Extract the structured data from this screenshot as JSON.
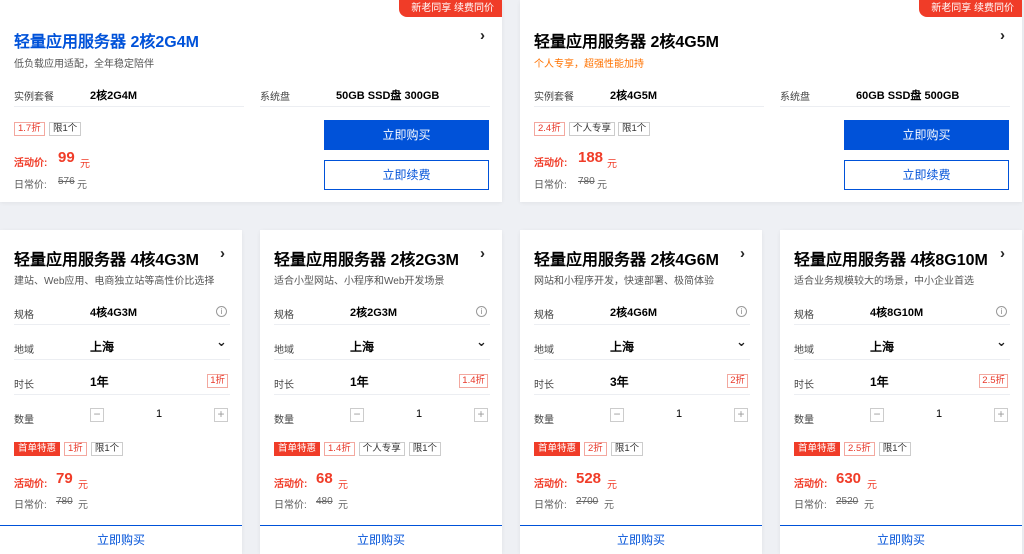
{
  "top_cards": [
    {
      "ribbon": "新老同享 续费同价",
      "title": "轻量应用服务器 2核2G4M",
      "subtitle": "低负载应用适配，全年稳定陪伴",
      "spec_label": "实例套餐",
      "spec_value": "2核2G4M",
      "disk_label": "系统盘",
      "disk_value": "50GB SSD盘 300GB",
      "tags": [
        "1.7折",
        "限1个"
      ],
      "price_label": "活动价:",
      "price": "99",
      "unit": "元",
      "orig_label": "日常价:",
      "orig_price": "576",
      "orig_unit": "元",
      "buy_label": "立即购买",
      "renew_label": "立即续费"
    },
    {
      "ribbon": "新老同享 续费同价",
      "title": "轻量应用服务器 2核4G5M",
      "subtitle": "个人专享，超强性能加持",
      "spec_label": "实例套餐",
      "spec_value": "2核4G5M",
      "disk_label": "系统盘",
      "disk_value": "60GB SSD盘 500GB",
      "tags": [
        "2.4折",
        "个人专享",
        "限1个"
      ],
      "price_label": "活动价:",
      "price": "188",
      "unit": "元",
      "orig_label": "日常价:",
      "orig_price": "780",
      "orig_unit": "元",
      "buy_label": "立即购买",
      "renew_label": "立即续费"
    }
  ],
  "cards": [
    {
      "title": "轻量应用服务器 4核4G3M",
      "subtitle": "建站、Web应用、电商独立站等高性价比选择",
      "spec_label": "规格",
      "spec_value": "4核4G3M",
      "region_label": "地域",
      "region_value": "上海",
      "duration_label": "时长",
      "duration_value": "1年",
      "duration_discount": "1折",
      "qty_label": "数量",
      "qty_value": "1",
      "tags": [
        "首单特惠",
        "1折",
        "限1个"
      ],
      "price_label": "活动价:",
      "price": "79",
      "unit": "元",
      "orig_label": "日常价:",
      "orig_price": "780",
      "orig_unit": "元",
      "buy_label": "立即购买"
    },
    {
      "title": "轻量应用服务器 2核2G3M",
      "subtitle": "适合小型网站、小程序和Web开发场景",
      "spec_label": "规格",
      "spec_value": "2核2G3M",
      "region_label": "地域",
      "region_value": "上海",
      "duration_label": "时长",
      "duration_value": "1年",
      "duration_discount": "1.4折",
      "qty_label": "数量",
      "qty_value": "1",
      "tags": [
        "首单特惠",
        "1.4折",
        "个人专享",
        "限1个"
      ],
      "price_label": "活动价:",
      "price": "68",
      "unit": "元",
      "orig_label": "日常价:",
      "orig_price": "480",
      "orig_unit": "元",
      "buy_label": "立即购买"
    },
    {
      "title": "轻量应用服务器 2核4G6M",
      "subtitle": "网站和小程序开发，快速部署、极简体验",
      "spec_label": "规格",
      "spec_value": "2核4G6M",
      "region_label": "地域",
      "region_value": "上海",
      "duration_label": "时长",
      "duration_value": "3年",
      "duration_discount": "2折",
      "qty_label": "数量",
      "qty_value": "1",
      "tags": [
        "首单特惠",
        "2折",
        "限1个"
      ],
      "price_label": "活动价:",
      "price": "528",
      "unit": "元",
      "orig_label": "日常价:",
      "orig_price": "2700",
      "orig_unit": "元",
      "buy_label": "立即购买"
    },
    {
      "title": "轻量应用服务器 4核8G10M",
      "subtitle": "适合业务规模较大的场景，中小企业首选",
      "spec_label": "规格",
      "spec_value": "4核8G10M",
      "region_label": "地域",
      "region_value": "上海",
      "duration_label": "时长",
      "duration_value": "1年",
      "duration_discount": "2.5折",
      "qty_label": "数量",
      "qty_value": "1",
      "tags": [
        "首单特惠",
        "2.5折",
        "限1个"
      ],
      "price_label": "活动价:",
      "price": "630",
      "unit": "元",
      "orig_label": "日常价:",
      "orig_price": "2520",
      "orig_unit": "元",
      "buy_label": "立即购买"
    }
  ],
  "icons": {
    "chevron_right": "›",
    "chevron_down": "⌄",
    "info": "i",
    "minus": "−",
    "plus": "+"
  },
  "colors": {
    "accent": "#0052d9",
    "promo": "#f03c28",
    "subtitle_orange": "#ff7200"
  }
}
